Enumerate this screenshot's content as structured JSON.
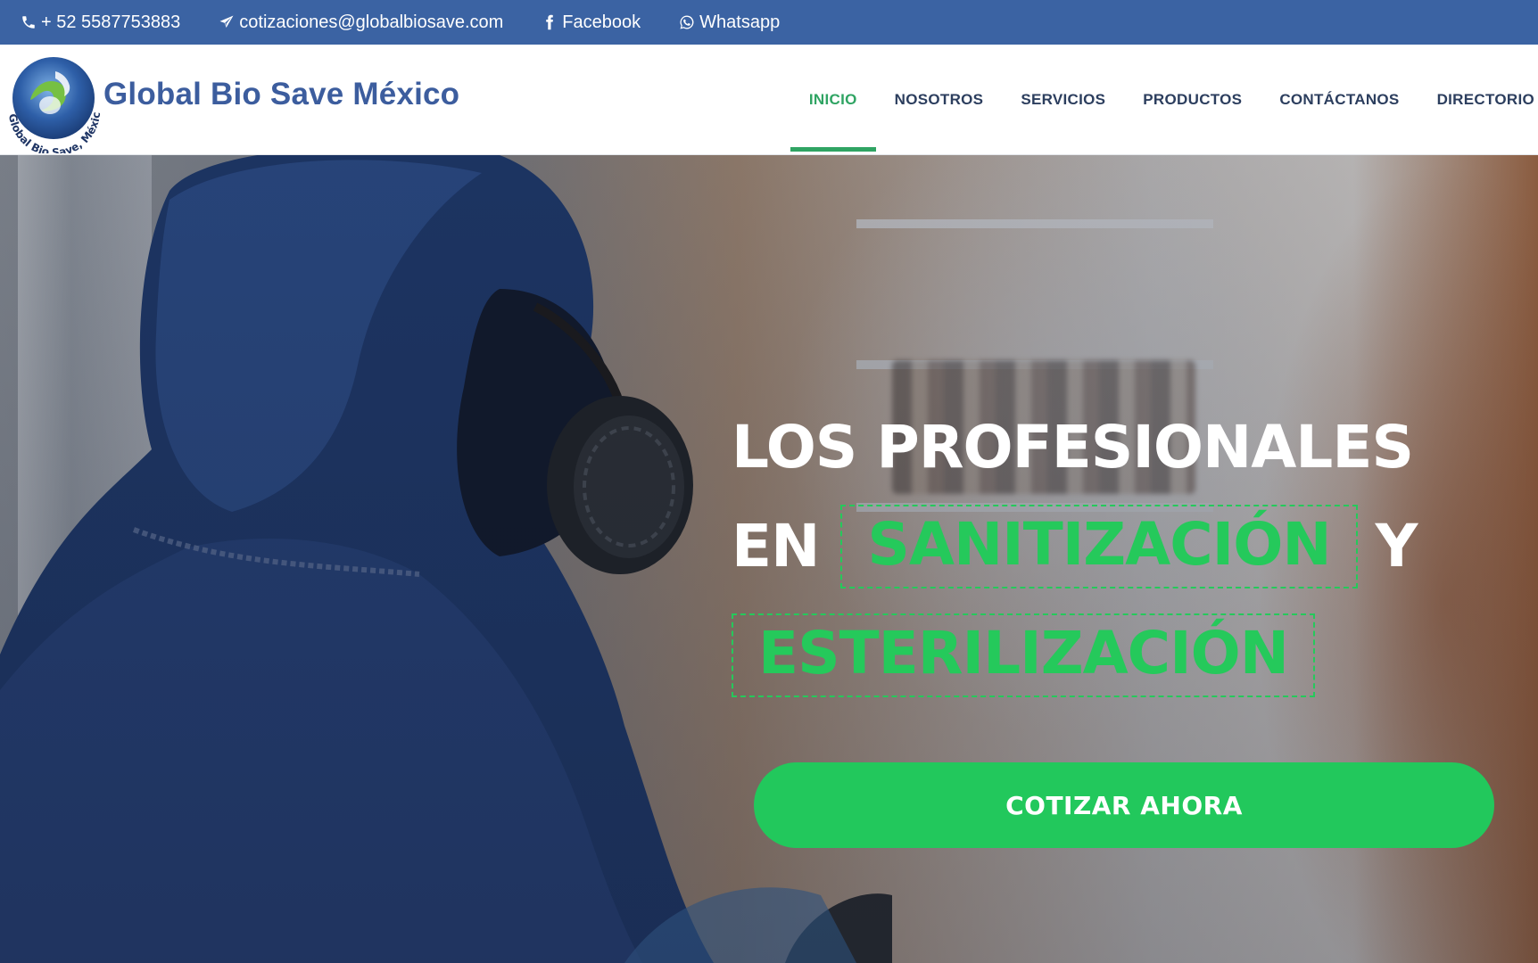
{
  "topbar": {
    "phone": "+ 52 5587753883",
    "email": "cotizaciones@globalbiosave.com",
    "facebook": "Facebook",
    "whatsapp": "Whatsapp",
    "background_color": "#3b63a3"
  },
  "header": {
    "brand": "Global Bio Save México",
    "logo_ring_text": "Global Bio Save, México",
    "nav": [
      {
        "label": "INICIO",
        "active": true
      },
      {
        "label": "NOSOTROS",
        "active": false
      },
      {
        "label": "SERVICIOS",
        "active": false
      },
      {
        "label": "PRODUCTOS",
        "active": false
      },
      {
        "label": "CONTÁCTANOS",
        "active": false
      },
      {
        "label": "DIRECTORIO",
        "active": false
      }
    ],
    "active_color": "#2fa463",
    "nav_color": "#2c3e5e"
  },
  "hero": {
    "line1": "LOS PROFESIONALES",
    "line2_start": "EN",
    "line2_highlight": "SANITIZACIÓN",
    "line2_end": "Y",
    "line3_highlight": "ESTERILIZACIÓN",
    "cta_label": "COTIZAR AHORA",
    "accent_color": "#22c85c"
  },
  "icons": {
    "phone": "phone-icon",
    "email": "paper-plane-icon",
    "facebook": "facebook-icon",
    "whatsapp": "whatsapp-icon"
  }
}
